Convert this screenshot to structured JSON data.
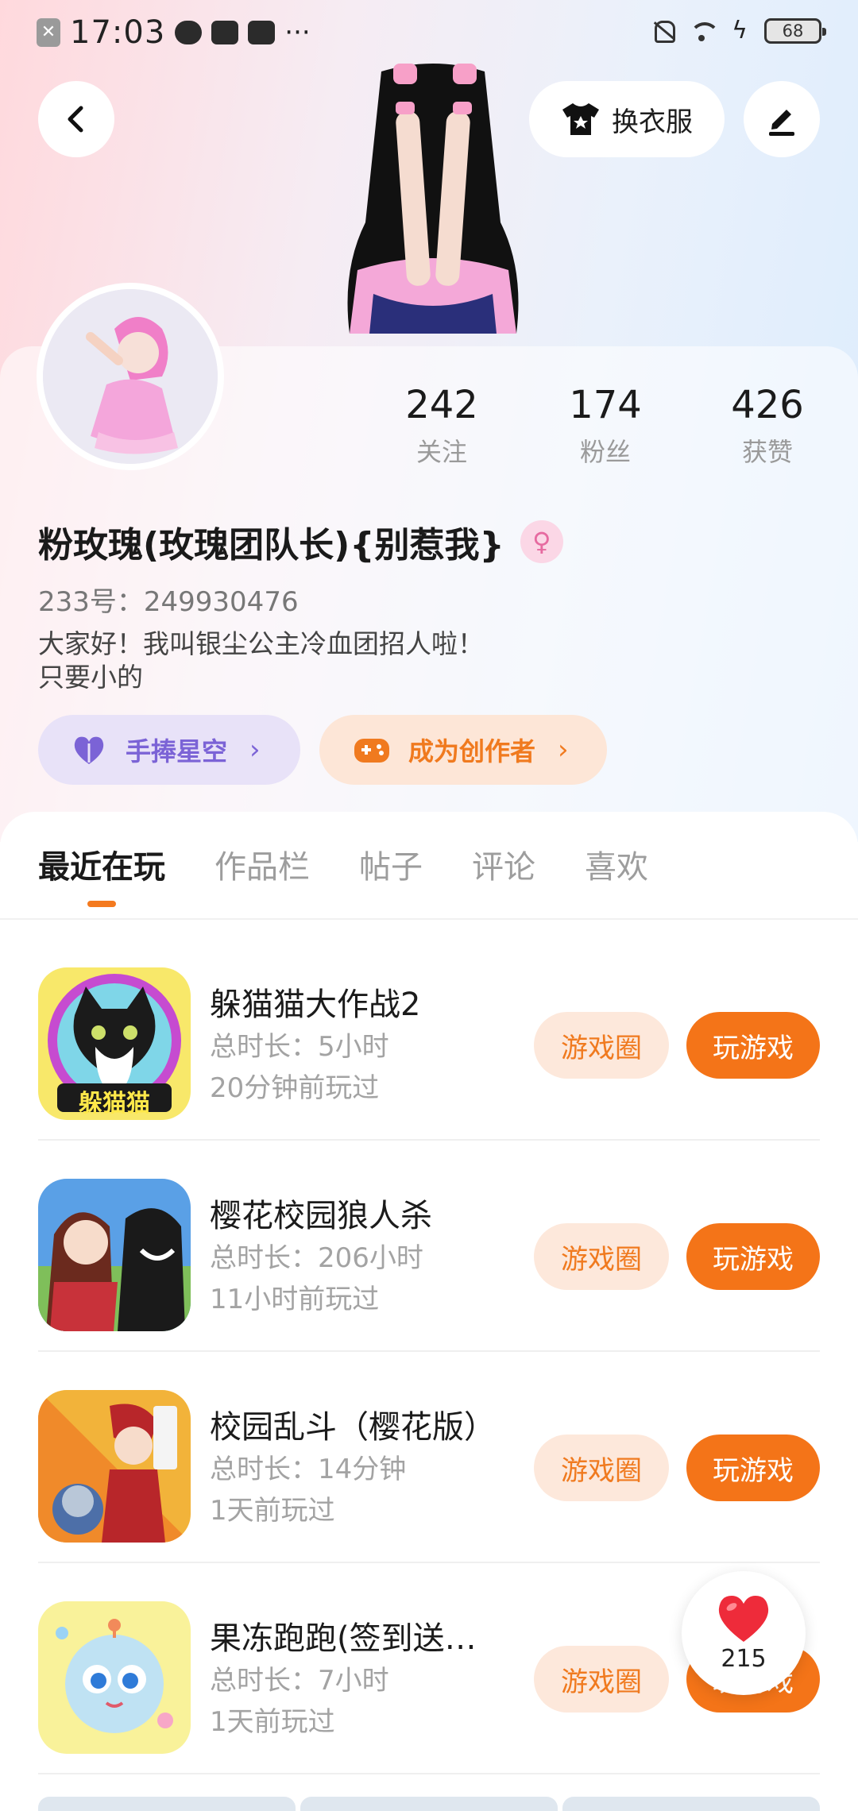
{
  "status_bar": {
    "time": "17:03",
    "more": "···",
    "battery": "68",
    "icons": [
      "sim-off-icon",
      "cloud-icon",
      "mail-icon",
      "card-icon",
      "bell-off-icon",
      "wifi-icon",
      "charging-icon",
      "battery-icon"
    ]
  },
  "header": {
    "outfit_label": "换衣服",
    "icons": [
      "back-icon",
      "shirt-icon",
      "edit-icon"
    ]
  },
  "profile": {
    "stats": [
      {
        "value": "242",
        "label": "关注"
      },
      {
        "value": "174",
        "label": "粉丝"
      },
      {
        "value": "426",
        "label": "获赞"
      }
    ],
    "name": "粉玫瑰(玫瑰团队长){别惹我}",
    "gender_icon": "female-icon",
    "uid": "233号：249930476",
    "bio_line1": "大家好！我叫银尘公主冷血团招人啦！",
    "bio_line2": "只要小的",
    "star_pill": "手捧星空",
    "creator_pill": "成为创作者"
  },
  "tabs": [
    {
      "label": "最近在玩",
      "active": true
    },
    {
      "label": "作品栏",
      "active": false
    },
    {
      "label": "帖子",
      "active": false
    },
    {
      "label": "评论",
      "active": false
    },
    {
      "label": "喜欢",
      "active": false
    }
  ],
  "games": [
    {
      "title": "躲猫猫大作战2",
      "duration": "总时长：5小时",
      "last_played": "20分钟前玩过",
      "icon_text": "躲猫猫",
      "circle_label": "游戏圈",
      "play_label": "玩游戏"
    },
    {
      "title": "樱花校园狼人杀",
      "duration": "总时长：206小时",
      "last_played": "11小时前玩过",
      "circle_label": "游戏圈",
      "play_label": "玩游戏"
    },
    {
      "title": "校园乱斗（樱花版）",
      "duration": "总时长：14分钟",
      "last_played": "1天前玩过",
      "circle_label": "游戏圈",
      "play_label": "玩游戏"
    },
    {
      "title": "果冻跑跑(签到送…",
      "duration": "总时长：7小时",
      "last_played": "1天前玩过",
      "circle_label": "游戏圈",
      "play_label": "玩游戏"
    }
  ],
  "like_fab": {
    "count": "215",
    "icon": "heart-icon"
  },
  "colors": {
    "accent_orange": "#f47418",
    "accent_purple": "#7b63d6",
    "soft_orange": "#fde8db"
  }
}
